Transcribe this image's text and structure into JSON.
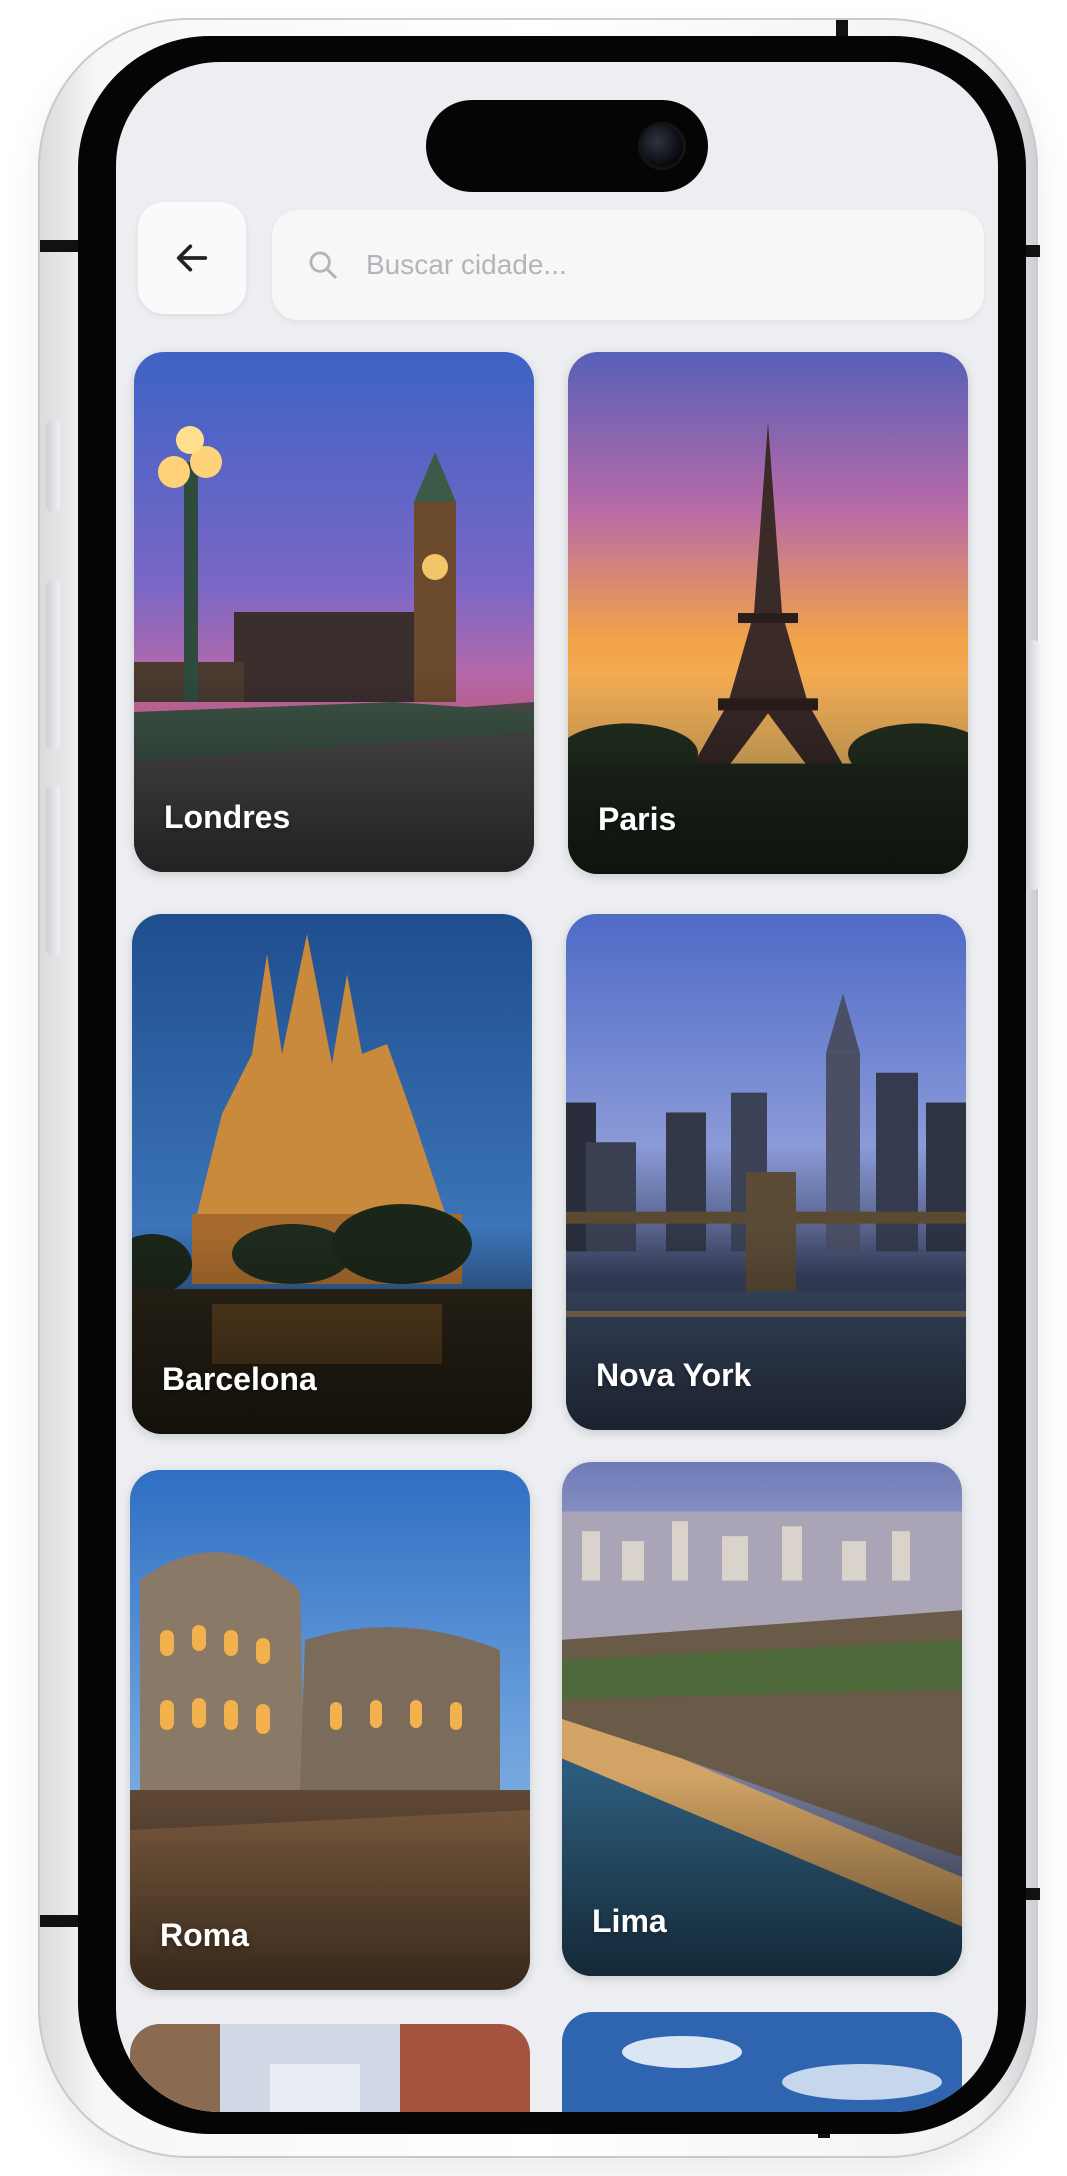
{
  "search": {
    "placeholder": "Buscar cidade..."
  },
  "cities": [
    {
      "name": "Londres"
    },
    {
      "name": "Paris"
    },
    {
      "name": "Barcelona"
    },
    {
      "name": "Nova York"
    },
    {
      "name": "Roma"
    },
    {
      "name": "Lima"
    }
  ],
  "icons": {
    "back": "arrow-left-icon",
    "search": "search-icon",
    "camera": "camera-icon"
  },
  "colors": {
    "screen_background": "#eceef1",
    "card_label": "#ffffff",
    "placeholder": "#b3b5ba"
  }
}
